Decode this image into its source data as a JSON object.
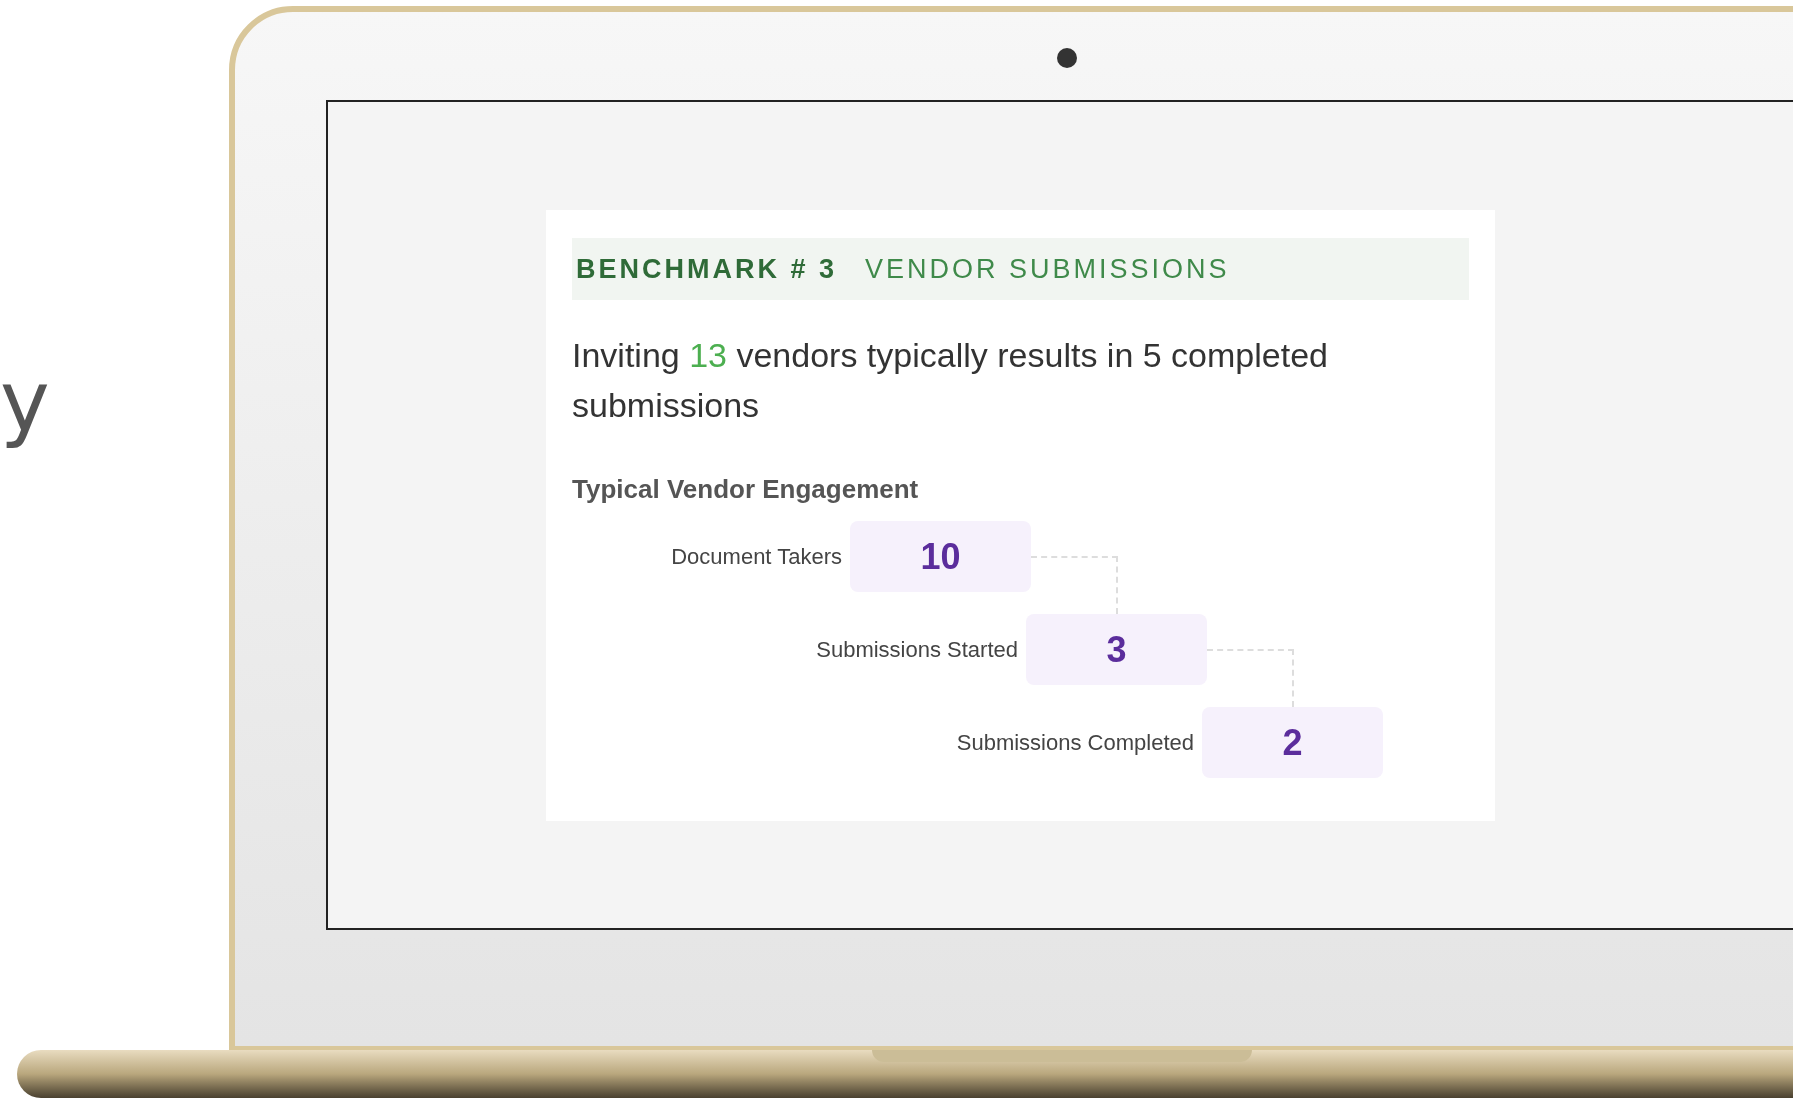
{
  "side_text": "y",
  "card": {
    "benchmark_label": "BENCHMARK # 3",
    "benchmark_title": "VENDOR SUBMISSIONS",
    "summary": {
      "before": "Inviting ",
      "highlight": "13",
      "after": " vendors typically results in 5 completed submissions"
    },
    "funnel_title": "Typical Vendor Engagement",
    "stages": [
      {
        "label": "Document Takers",
        "value": "10"
      },
      {
        "label": "Submissions Started",
        "value": "3"
      },
      {
        "label": "Submissions Completed",
        "value": "2"
      }
    ]
  }
}
